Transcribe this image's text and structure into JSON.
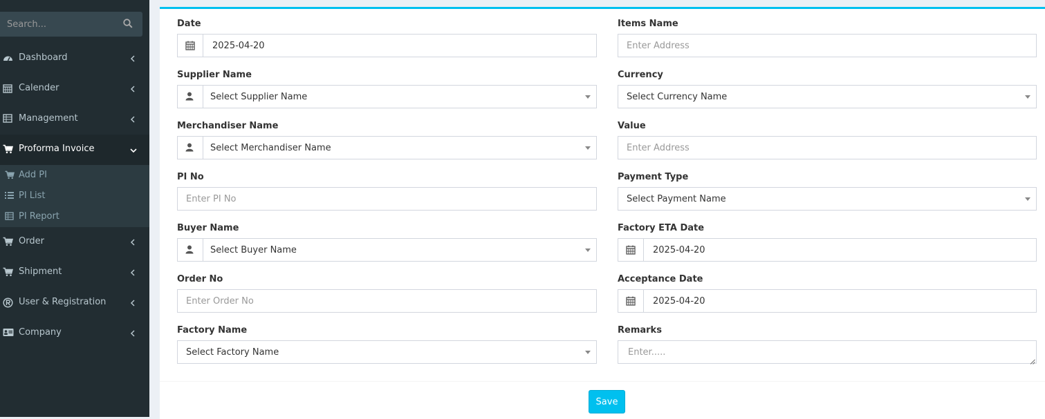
{
  "sidebar": {
    "search_placeholder": "Search...",
    "menu": [
      {
        "label": "Dashboard",
        "icon": "dashboard-icon"
      },
      {
        "label": "Calender",
        "icon": "calendar-icon"
      },
      {
        "label": "Management",
        "icon": "table-icon"
      },
      {
        "label": "Proforma Invoice",
        "icon": "cart-icon",
        "active": true
      },
      {
        "label": "Order",
        "icon": "cart-icon"
      },
      {
        "label": "Shipment",
        "icon": "cart-icon"
      },
      {
        "label": "User & Registration",
        "icon": "registered-icon"
      },
      {
        "label": "Company",
        "icon": "id-card-icon"
      }
    ],
    "submenu": [
      {
        "label": "Add PI",
        "icon": "cart-icon"
      },
      {
        "label": "PI List",
        "icon": "list-icon"
      },
      {
        "label": "PI Report",
        "icon": "table-icon"
      }
    ]
  },
  "form": {
    "date": {
      "label": "Date",
      "value": "2025-04-20"
    },
    "supplier": {
      "label": "Supplier Name",
      "value": "Select Supplier Name"
    },
    "merchandiser": {
      "label": "Merchandiser Name",
      "value": "Select Merchandiser Name"
    },
    "pi_no": {
      "label": "PI No",
      "placeholder": "Enter PI No"
    },
    "buyer": {
      "label": "Buyer Name",
      "value": "Select Buyer Name"
    },
    "order_no": {
      "label": "Order No",
      "placeholder": "Enter Order No"
    },
    "factory": {
      "label": "Factory Name",
      "value": "Select Factory Name"
    },
    "items": {
      "label": "Items Name",
      "placeholder": "Enter Address"
    },
    "currency": {
      "label": "Currency",
      "value": "Select Currency Name"
    },
    "value": {
      "label": "Value",
      "placeholder": "Enter Address"
    },
    "payment": {
      "label": "Payment Type",
      "value": "Select Payment Name"
    },
    "factory_eta": {
      "label": "Factory ETA Date",
      "value": "2025-04-20"
    },
    "acceptance": {
      "label": "Acceptance Date",
      "value": "2025-04-20"
    },
    "remarks": {
      "label": "Remarks",
      "placeholder": "Enter....."
    }
  },
  "save_label": "Save",
  "colors": {
    "sidebar_bg": "#222d32",
    "accent": "#00c0ef",
    "active_bg": "#1e282c"
  }
}
